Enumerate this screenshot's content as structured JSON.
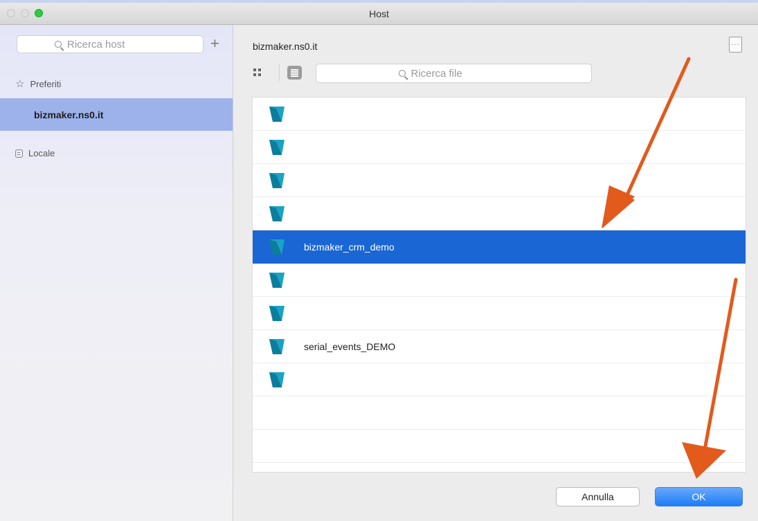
{
  "window": {
    "title": "Host"
  },
  "sidebar": {
    "search_placeholder": "Ricerca host",
    "sections": {
      "favorites": "Preferiti",
      "local": "Locale"
    },
    "selected_host": "bizmaker.ns0.it"
  },
  "main": {
    "current_host": "bizmaker.ns0.it",
    "file_search_placeholder": "Ricerca file",
    "files": [
      {
        "name": ""
      },
      {
        "name": ""
      },
      {
        "name": ""
      },
      {
        "name": ""
      },
      {
        "name": "bizmaker_crm_demo",
        "selected": true
      },
      {
        "name": ""
      },
      {
        "name": ""
      },
      {
        "name": "serial_events_DEMO"
      },
      {
        "name": ""
      }
    ]
  },
  "buttons": {
    "cancel": "Annulla",
    "ok": "OK"
  },
  "colors": {
    "selection": "#1a66d4",
    "sidebar_selection": "#9db1eb",
    "annotation_arrow": "#e25a1c",
    "file_icon": "#1aa3c4"
  },
  "icons": [
    "search-icon",
    "add-icon",
    "star-icon",
    "locale-icon",
    "grid-view-icon",
    "list-view-icon",
    "more-icon",
    "filemaker-file-icon"
  ]
}
